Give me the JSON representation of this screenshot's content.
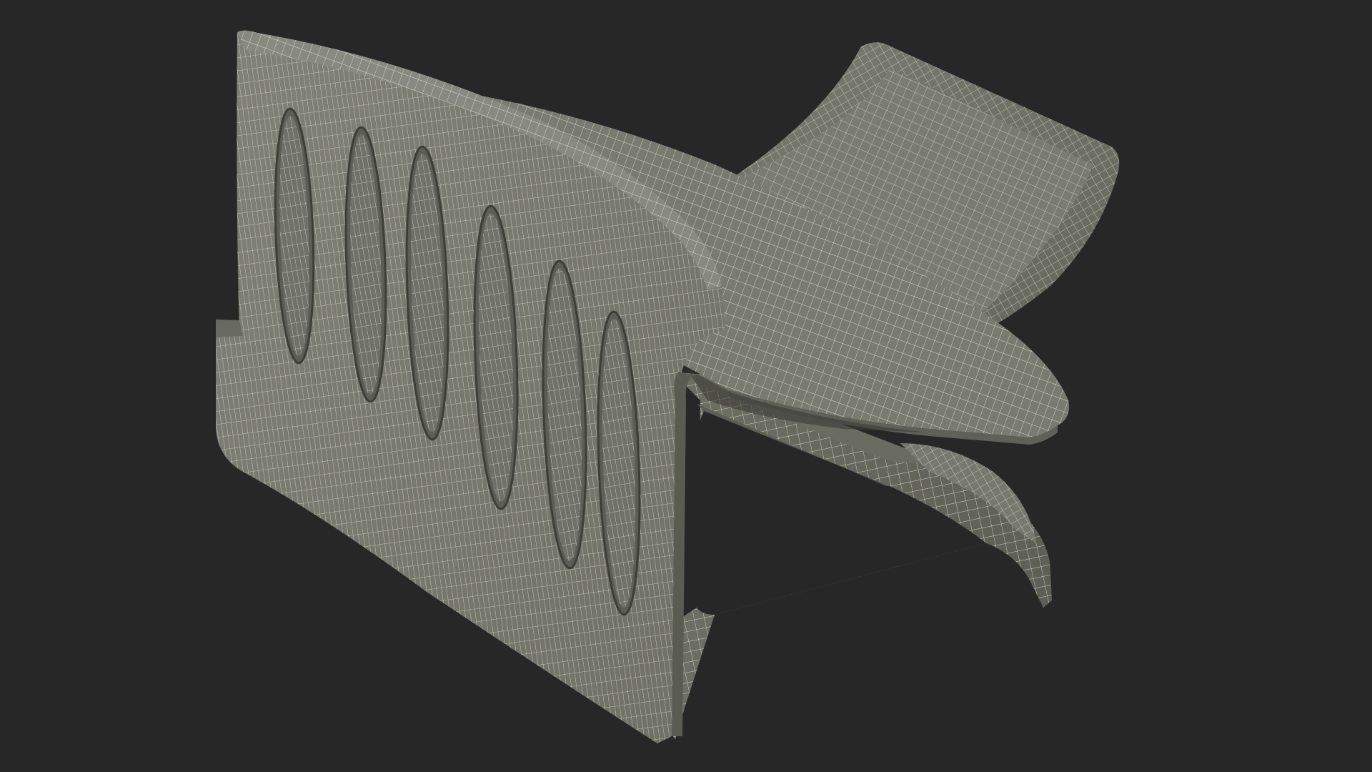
{
  "viewport": {
    "background_color": "#272727",
    "subject": "wireframe-3d-model",
    "render_mode": "wireframe-over-shaded",
    "colors": {
      "surface_light": "#7c7d72",
      "surface_mid": "#6d6e64",
      "surface_dark": "#55564d",
      "wire": "#e4e6da",
      "groove": "#44453e"
    }
  }
}
